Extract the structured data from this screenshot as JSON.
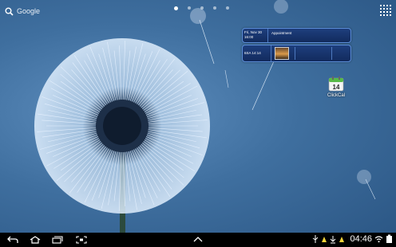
{
  "search": {
    "label": "Google",
    "icon": "search-icon"
  },
  "pager": {
    "count": 5,
    "active_index": 0
  },
  "widget": {
    "row1": {
      "date_line1": "Fri, Nov 30",
      "date_line2": "16:00",
      "title": "Appointment"
    },
    "row2": {
      "date": "6SA 14:14"
    }
  },
  "shortcut": {
    "label": "ClickCal",
    "day": "14",
    "accent": "#58b947"
  },
  "status_bar": {
    "time": "04:46"
  }
}
